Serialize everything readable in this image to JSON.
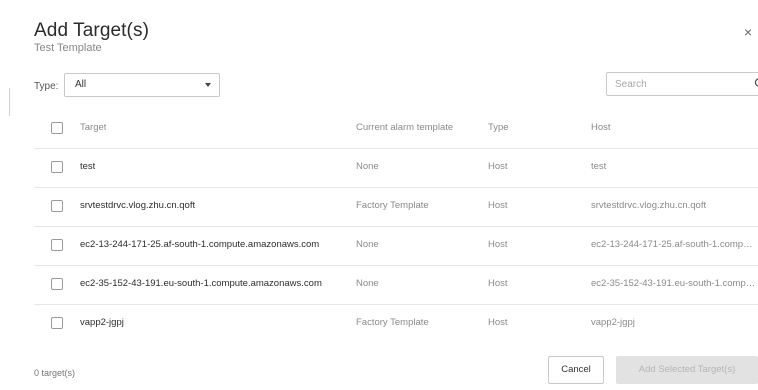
{
  "dialog": {
    "title": "Add Target(s)",
    "subtitle": "Test Template",
    "close_label": "×"
  },
  "filters": {
    "type_label": "Type:",
    "type_value": "All",
    "search_placeholder": "Search"
  },
  "table": {
    "columns": [
      "Target",
      "Current alarm template",
      "Type",
      "Host"
    ],
    "rows": [
      {
        "target": "test",
        "alarm_template": "None",
        "type": "Host",
        "host": "test"
      },
      {
        "target": "srvtestdrvc.vlog.zhu.cn.qoft",
        "alarm_template": "Factory Template",
        "type": "Host",
        "host": "srvtestdrvc.vlog.zhu.cn.qoft"
      },
      {
        "target": "ec2-13-244-171-25.af-south-1.compute.amazonaws.com",
        "alarm_template": "None",
        "type": "Host",
        "host": "ec2-13-244-171-25.af-south-1.comp…"
      },
      {
        "target": "ec2-35-152-43-191.eu-south-1.compute.amazonaws.com",
        "alarm_template": "None",
        "type": "Host",
        "host": "ec2-35-152-43-191.eu-south-1.comp…"
      },
      {
        "target": "vapp2-jgpj",
        "alarm_template": "Factory Template",
        "type": "Host",
        "host": "vapp2-jgpj"
      }
    ]
  },
  "footer": {
    "selected_count": "0 target(s)",
    "cancel_label": "Cancel",
    "add_label": "Add Selected Target(s)"
  }
}
